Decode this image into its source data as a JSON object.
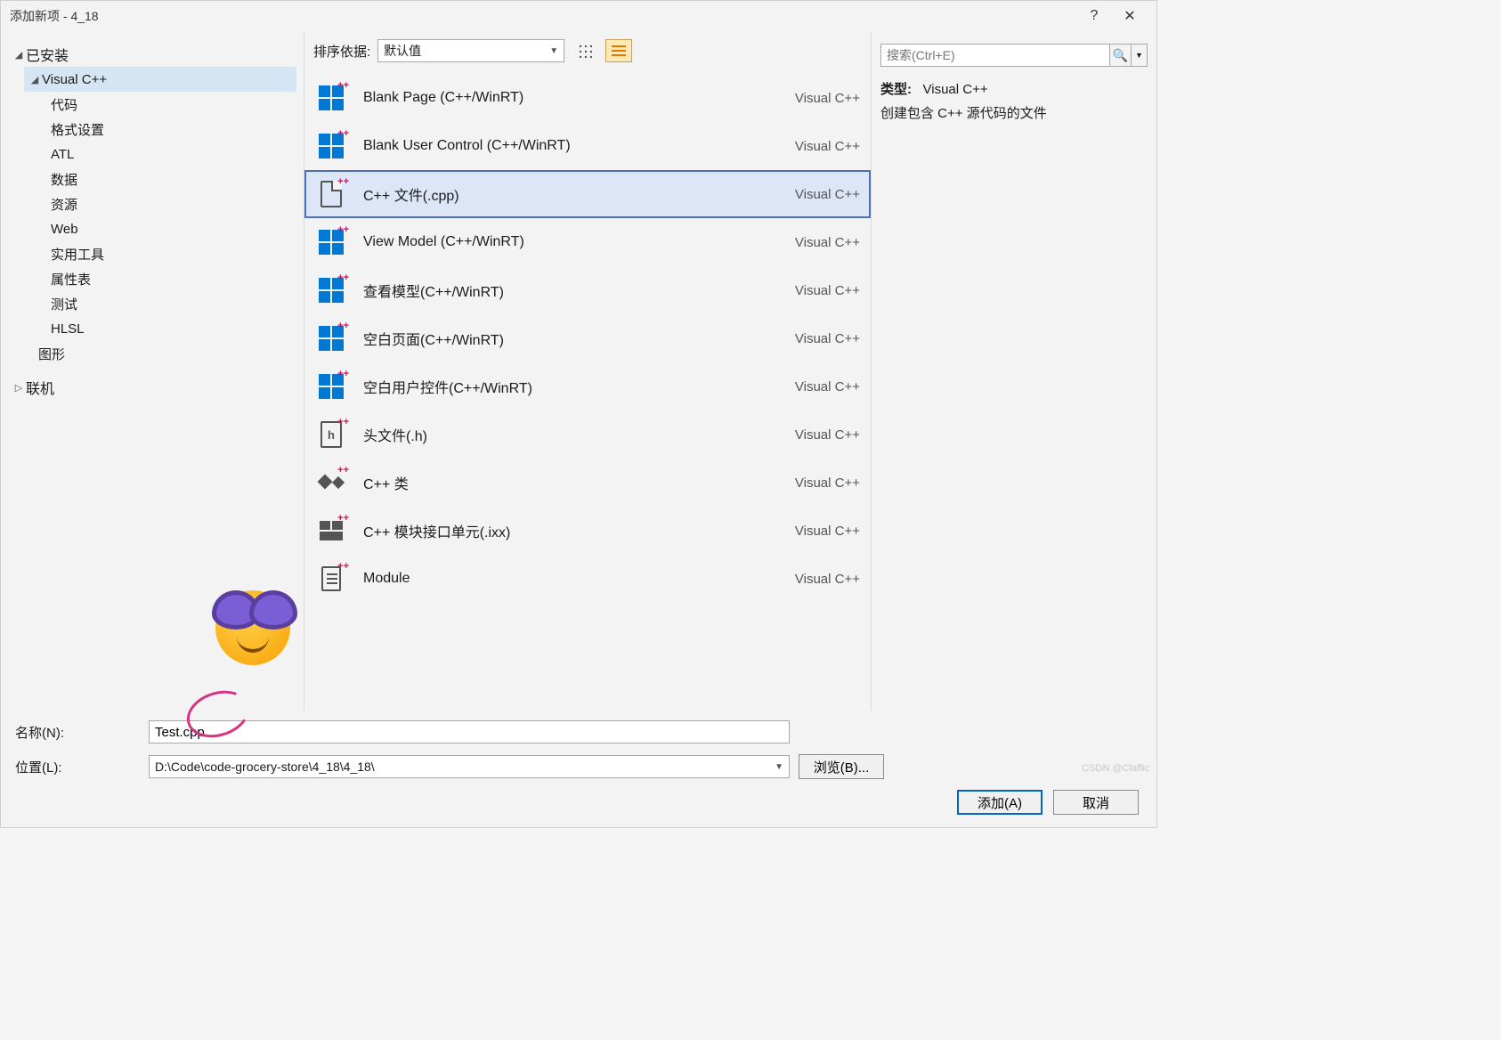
{
  "window_title": "添加新项 - 4_18",
  "help_char": "?",
  "close_char": "✕",
  "sidebar": {
    "installed": "已安装",
    "vcpp": "Visual C++",
    "items": [
      "代码",
      "格式设置",
      "ATL",
      "数据",
      "资源",
      "Web",
      "实用工具",
      "属性表",
      "测试",
      "HLSL"
    ],
    "graphics": "图形",
    "online": "联机"
  },
  "toolbar": {
    "sort_label": "排序依据:",
    "sort_value": "默认值"
  },
  "templates": [
    {
      "label": "Blank Page (C++/WinRT)",
      "cat": "Visual C++",
      "icon": "win"
    },
    {
      "label": "Blank User Control (C++/WinRT)",
      "cat": "Visual C++",
      "icon": "win"
    },
    {
      "label": "C++ 文件(.cpp)",
      "cat": "Visual C++",
      "icon": "doc",
      "selected": true
    },
    {
      "label": "View Model (C++/WinRT)",
      "cat": "Visual C++",
      "icon": "win"
    },
    {
      "label": "查看模型(C++/WinRT)",
      "cat": "Visual C++",
      "icon": "win"
    },
    {
      "label": "空白页面(C++/WinRT)",
      "cat": "Visual C++",
      "icon": "win"
    },
    {
      "label": "空白用户控件(C++/WinRT)",
      "cat": "Visual C++",
      "icon": "win"
    },
    {
      "label": "头文件(.h)",
      "cat": "Visual C++",
      "icon": "h"
    },
    {
      "label": "C++ 类",
      "cat": "Visual C++",
      "icon": "class"
    },
    {
      "label": "C++ 模块接口单元(.ixx)",
      "cat": "Visual C++",
      "icon": "mod"
    },
    {
      "label": "Module",
      "cat": "Visual C++",
      "icon": "modfile"
    }
  ],
  "right": {
    "search_placeholder": "搜索(Ctrl+E)",
    "type_label": "类型:",
    "type_value": "Visual C++",
    "desc": "创建包含 C++ 源代码的文件"
  },
  "form": {
    "name_label": "名称(N):",
    "name_value": "Test.cpp",
    "location_label": "位置(L):",
    "location_value": "D:\\Code\\code-grocery-store\\4_18\\4_18\\",
    "browse": "浏览(B)...",
    "add": "添加(A)",
    "cancel": "取消"
  },
  "watermark": "CSDN @Claffic"
}
